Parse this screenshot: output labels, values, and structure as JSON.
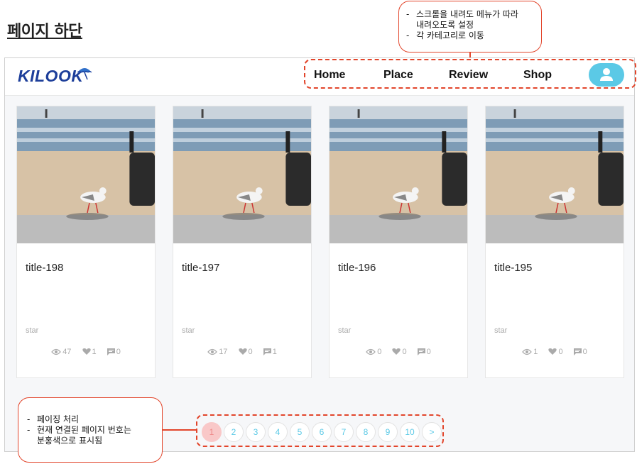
{
  "page_heading": "페이지 하단",
  "navbar": {
    "logo": "KILOOK",
    "items": [
      "Home",
      "Place",
      "Review",
      "Shop"
    ]
  },
  "cards": [
    {
      "title": "title-198",
      "subtitle": "star",
      "views": "47",
      "likes": "1",
      "comments": "0"
    },
    {
      "title": "title-197",
      "subtitle": "star",
      "views": "17",
      "likes": "0",
      "comments": "1"
    },
    {
      "title": "title-196",
      "subtitle": "star",
      "views": "0",
      "likes": "0",
      "comments": "0"
    },
    {
      "title": "title-195",
      "subtitle": "star",
      "views": "1",
      "likes": "0",
      "comments": "0"
    }
  ],
  "pagination": {
    "pages": [
      "1",
      "2",
      "3",
      "4",
      "5",
      "6",
      "7",
      "8",
      "9",
      "10"
    ],
    "next": ">",
    "current": "1"
  },
  "annotations": {
    "top": [
      "스크롤을 내려도 메뉴가 따라\n내려오도록 설정",
      "각 카테고리로 이동"
    ],
    "bottom": [
      "페이징 처리",
      "현재 연결된 페이지 번호는\n분홍색으로 표시됨"
    ]
  },
  "colors": {
    "accent": "#5bc9e6",
    "active_page": "#f9c8c8",
    "annotation": "#e2452b",
    "logo": "#1d3e9a"
  }
}
